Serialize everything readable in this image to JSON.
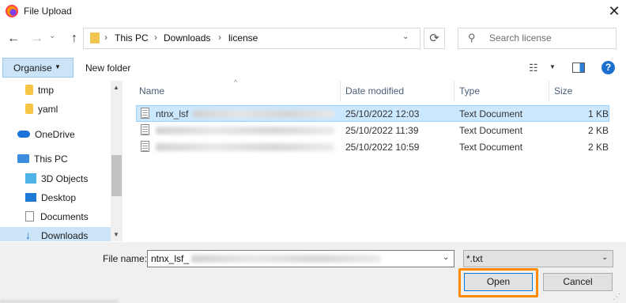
{
  "window": {
    "title": "File Upload",
    "close_glyph": "✕"
  },
  "nav": {
    "back_glyph": "←",
    "forward_glyph": "→",
    "history_glyph": "⌄",
    "up_glyph": "↑",
    "breadcrumbs": [
      "This PC",
      "Downloads",
      "license"
    ],
    "separator": "›",
    "dropdown_glyph": "⌄",
    "refresh_glyph": "⟳",
    "search_placeholder": "Search license",
    "search_glyph": "⚲"
  },
  "toolbar": {
    "organise": "Organise",
    "organise_caret": "▼",
    "new_folder": "New folder",
    "view_glyph": "☷",
    "view_caret": "▼",
    "help_glyph": "?"
  },
  "sidebar": {
    "items": [
      {
        "label": "tmp",
        "icon": "yaml-file-icon"
      },
      {
        "label": "yaml",
        "icon": "yaml-file-icon"
      },
      {
        "label": "OneDrive",
        "icon": "cloud-icon"
      },
      {
        "label": "This PC",
        "icon": "computer-icon"
      },
      {
        "label": "3D Objects",
        "icon": "cube-icon"
      },
      {
        "label": "Desktop",
        "icon": "desktop-icon"
      },
      {
        "label": "Documents",
        "icon": "document-icon"
      },
      {
        "label": "Downloads",
        "icon": "download-icon"
      }
    ],
    "scroll_up": "▲",
    "scroll_down": "▼"
  },
  "filelist": {
    "columns": [
      "Name",
      "Date modified",
      "Type",
      "Size"
    ],
    "sort_caret": "^",
    "rows": [
      {
        "name": "ntnx_lsf",
        "date": "25/10/2022 12:03",
        "type": "Text Document",
        "size": "1 KB",
        "selected": true
      },
      {
        "name": "",
        "date": "25/10/2022 11:39",
        "type": "Text Document",
        "size": "2 KB",
        "selected": false
      },
      {
        "name": "",
        "date": "25/10/2022 10:59",
        "type": "Text Document",
        "size": "2 KB",
        "selected": false
      }
    ]
  },
  "bottom": {
    "file_name_label": "File name:",
    "file_name_value": "ntnx_lsf_",
    "file_name_caret": "⌄",
    "file_type_value": "*.txt",
    "file_type_caret": "⌄",
    "open_label": "Open",
    "cancel_label": "Cancel",
    "grip_glyph": "⋰"
  },
  "colors": {
    "accent": "#0078d7",
    "highlight": "#ff8c00",
    "selection": "#cce8ff"
  }
}
